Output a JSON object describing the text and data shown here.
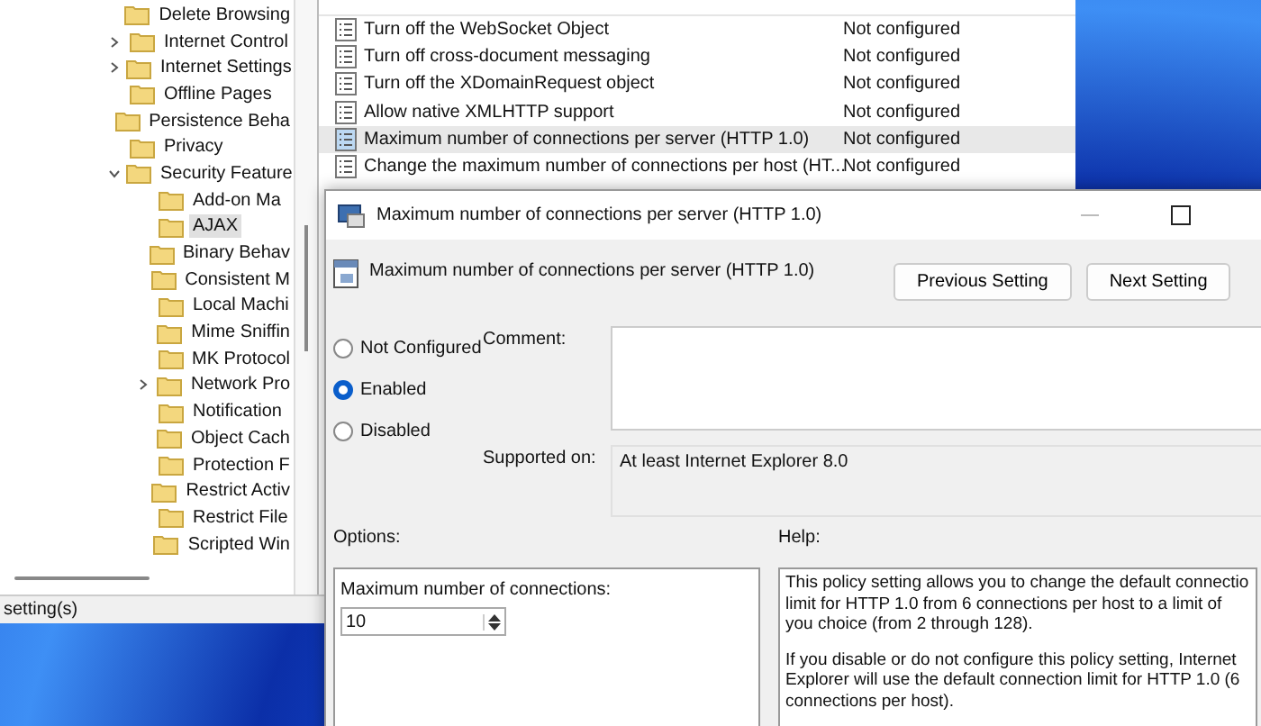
{
  "background_window": {
    "tree": [
      {
        "label": "Delete Browsing",
        "selected": false
      },
      {
        "label": "Internet Control",
        "selected": false,
        "expanded": false
      },
      {
        "label": "Internet Settings",
        "selected": false,
        "expanded": false
      },
      {
        "label": "Offline Pages",
        "selected": false
      },
      {
        "label": "Persistence Beha",
        "selected": false
      },
      {
        "label": "Privacy",
        "selected": false
      },
      {
        "label": "Security Feature",
        "selected": false,
        "expanded": true,
        "children": [
          {
            "label": "Add-on Ma",
            "selected": false
          },
          {
            "label": "AJAX",
            "selected": true
          },
          {
            "label": "Binary Behav",
            "selected": false
          },
          {
            "label": "Consistent M",
            "selected": false
          },
          {
            "label": "Local Machi",
            "selected": false
          },
          {
            "label": "Mime Sniffin",
            "selected": false
          },
          {
            "label": "MK Protocol",
            "selected": false
          },
          {
            "label": "Network Pro",
            "selected": false,
            "expanded": false
          },
          {
            "label": "Notification",
            "selected": false
          },
          {
            "label": "Object Cach",
            "selected": false
          },
          {
            "label": "Protection F",
            "selected": false
          },
          {
            "label": "Restrict Activ",
            "selected": false
          },
          {
            "label": "Restrict File",
            "selected": false
          },
          {
            "label": "Scripted Win",
            "selected": false
          }
        ]
      }
    ],
    "table": {
      "rows": [
        {
          "name": "Turn off the WebSocket Object",
          "state": "Not configured",
          "selected": false
        },
        {
          "name": "Turn off cross-document messaging",
          "state": "Not configured",
          "selected": false
        },
        {
          "name": "Turn off the XDomainRequest object",
          "state": "Not configured",
          "selected": false
        },
        {
          "name": "Allow native XMLHTTP support",
          "state": "Not configured",
          "selected": false
        },
        {
          "name": "Maximum number of connections per server (HTTP 1.0)",
          "state": "Not configured",
          "selected": true
        },
        {
          "name": "Change the maximum number of connections per host (HT...",
          "state": "Not configured",
          "selected": false
        }
      ]
    },
    "status_bar": "setting(s)"
  },
  "dialog": {
    "title": "Maximum number of connections per server (HTTP 1.0)",
    "heading": "Maximum number of connections per server (HTTP 1.0)",
    "buttons": [
      "Previous Setting",
      "Next Setting"
    ],
    "radios": [
      {
        "label": "Not Configured",
        "selected": false
      },
      {
        "label": "Enabled",
        "selected": true
      },
      {
        "label": "Disabled",
        "selected": false
      }
    ],
    "comment_label": "Comment:",
    "supported_label": "Supported on:",
    "supported_value": "At least Internet Explorer 8.0",
    "options_label": "Options:",
    "help_label": "Help:",
    "option_field_label": "Maximum number of connections:",
    "option_value": "10",
    "help_paragraphs": [
      "This policy setting allows you to change the default connectio limit for HTTP 1.0 from 6 connections per host to a limit of you choice (from 2 through 128).",
      "If you disable or do not configure this policy setting, Internet Explorer will use the default connection limit for HTTP 1.0 (6 connections per host)."
    ]
  }
}
